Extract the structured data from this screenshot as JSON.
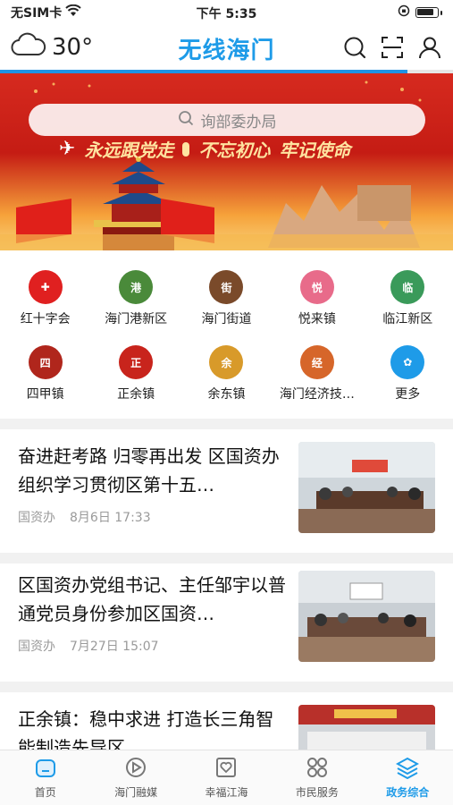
{
  "status_bar": {
    "carrier": "无SIM卡",
    "time": "下午 5:35"
  },
  "header": {
    "temperature": "30°",
    "title": "无线海门",
    "weather_icon": "cloud-icon",
    "icons": [
      "search-icon",
      "scan-icon",
      "user-icon"
    ],
    "load_progress": 0.9
  },
  "banner": {
    "search_placeholder": "询部委办局",
    "slogan_1": "永远跟党走",
    "slogan_2": "不忘初心",
    "slogan_3": "牢记使命"
  },
  "categories": [
    {
      "label": "红十字会",
      "color": "#e02020",
      "glyph": "✚"
    },
    {
      "label": "海门港新区",
      "color": "#4a8a3a",
      "glyph": "港"
    },
    {
      "label": "海门街道",
      "color": "#7a4a2a",
      "glyph": "街"
    },
    {
      "label": "悦来镇",
      "color": "#e86b8a",
      "glyph": "悦"
    },
    {
      "label": "临江新区",
      "color": "#3a9a5a",
      "glyph": "临"
    },
    {
      "label": "四甲镇",
      "color": "#b0261c",
      "glyph": "四"
    },
    {
      "label": "正余镇",
      "color": "#c8241c",
      "glyph": "正"
    },
    {
      "label": "余东镇",
      "color": "#d89a2a",
      "glyph": "余"
    },
    {
      "label": "海门经济技…",
      "color": "#d6662a",
      "glyph": "经"
    },
    {
      "label": "更多",
      "color": "#1e9be8",
      "glyph": "✿"
    }
  ],
  "news": [
    {
      "title": "奋进赶考路 归零再出发 区国资办组织学习贯彻区第十五…",
      "source": "国资办",
      "date": "8月6日 17:33"
    },
    {
      "title": "区国资办党组书记、主任邹宇以普通党员身份参加区国资…",
      "source": "国资办",
      "date": "7月27日 15:07"
    },
    {
      "title": "正余镇：稳中求进 打造长三角智能制造先导区",
      "source": "",
      "date": ""
    }
  ],
  "bottom_nav": [
    {
      "label": "首页",
      "icon": "home-icon",
      "active": false
    },
    {
      "label": "海门融媒",
      "icon": "media-icon",
      "active": false
    },
    {
      "label": "幸福江海",
      "icon": "heart-icon",
      "active": false
    },
    {
      "label": "市民服务",
      "icon": "grid-icon",
      "active": false
    },
    {
      "label": "政务综合",
      "icon": "layers-icon",
      "active": true
    }
  ]
}
